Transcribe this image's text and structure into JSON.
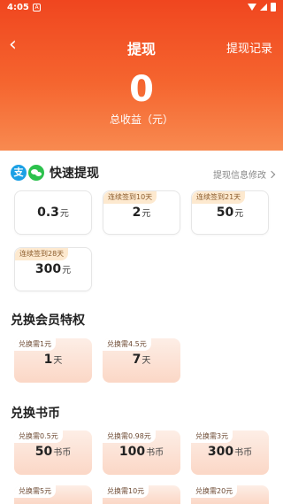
{
  "status_bar": {
    "time": "4:05",
    "app_icon": "A"
  },
  "header": {
    "back_icon": "‹",
    "title": "提现",
    "record_link": "提现记录",
    "balance": "0",
    "balance_label": "总收益（元）"
  },
  "quick": {
    "alipay_glyph": "支",
    "title": "快速提现",
    "info_link": "提现信息修改",
    "options": [
      {
        "tag": "",
        "amount": "0.3",
        "unit": "元"
      },
      {
        "tag": "连续签到10天",
        "amount": "2",
        "unit": "元"
      },
      {
        "tag": "连续签到21天",
        "amount": "50",
        "unit": "元"
      },
      {
        "tag": "连续签到28天",
        "amount": "300",
        "unit": "元"
      }
    ]
  },
  "vip": {
    "title": "兑换会员特权",
    "options": [
      {
        "tag": "兑换需1元",
        "amount": "1",
        "unit": "天"
      },
      {
        "tag": "兑换需4.5元",
        "amount": "7",
        "unit": "天"
      }
    ]
  },
  "coins": {
    "title": "兑换书币",
    "options": [
      {
        "tag": "兑换需0.5元",
        "amount": "50",
        "unit": "书币"
      },
      {
        "tag": "兑换需0.98元",
        "amount": "100",
        "unit": "书币"
      },
      {
        "tag": "兑换需3元",
        "amount": "300",
        "unit": "书币"
      },
      {
        "tag": "兑换需5元",
        "amount": "",
        "unit": ""
      },
      {
        "tag": "兑换需10元",
        "amount": "",
        "unit": ""
      },
      {
        "tag": "兑换需20元",
        "amount": "",
        "unit": ""
      }
    ]
  },
  "colors": {
    "header_top": "#f0461f",
    "header_bottom": "#f88a50",
    "tag_bg": "#fde9cf"
  }
}
